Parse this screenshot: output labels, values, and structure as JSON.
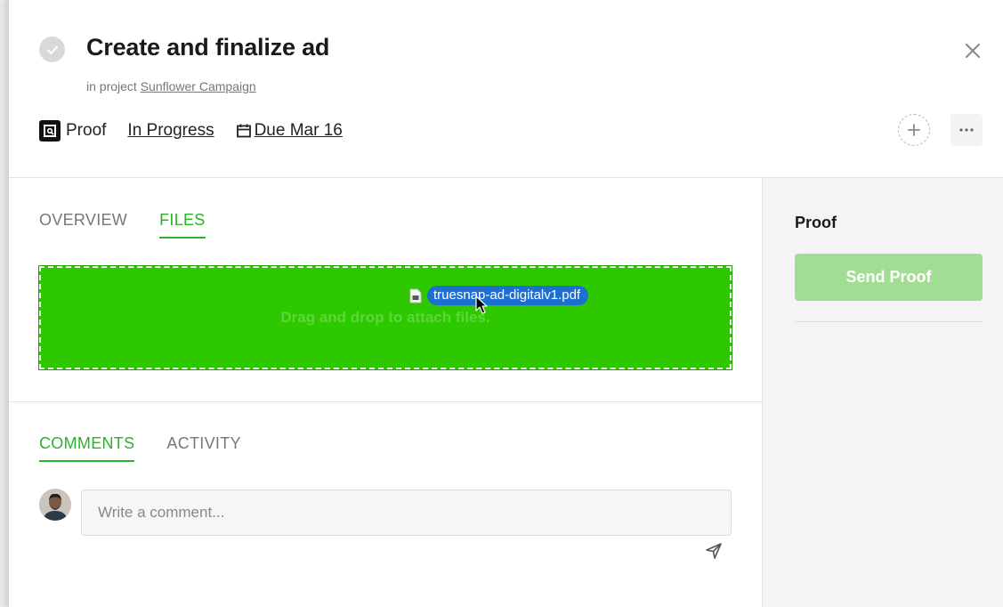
{
  "header": {
    "title": "Create and finalize ad",
    "project_prefix": "in project",
    "project_name": "Sunflower Campaign",
    "type_label": "Proof",
    "status": "In Progress",
    "due": "Due Mar 16",
    "icons": {
      "complete": "check-icon",
      "close": "close-icon",
      "type": "proof-icon",
      "due": "calendar-icon",
      "add_member": "add-member-icon",
      "more": "more-icon"
    }
  },
  "files_section": {
    "tabs": [
      {
        "label": "OVERVIEW",
        "active": false
      },
      {
        "label": "FILES",
        "active": true
      }
    ],
    "dropzone_text": "Drag and drop to attach files.",
    "dragged_file": "truesnap-ad-digitalv1.pdf"
  },
  "comments_section": {
    "tabs": [
      {
        "label": "COMMENTS",
        "active": true
      },
      {
        "label": "ACTIVITY",
        "active": false
      }
    ],
    "comment_placeholder": "Write a comment..."
  },
  "sidebar": {
    "title": "Proof",
    "send_button": "Send Proof"
  },
  "colors": {
    "accent_green": "#2ab22a",
    "dropzone_green": "#2dc800",
    "send_button_bg": "#a3dd93",
    "file_chip_blue": "#1e6fd2"
  }
}
